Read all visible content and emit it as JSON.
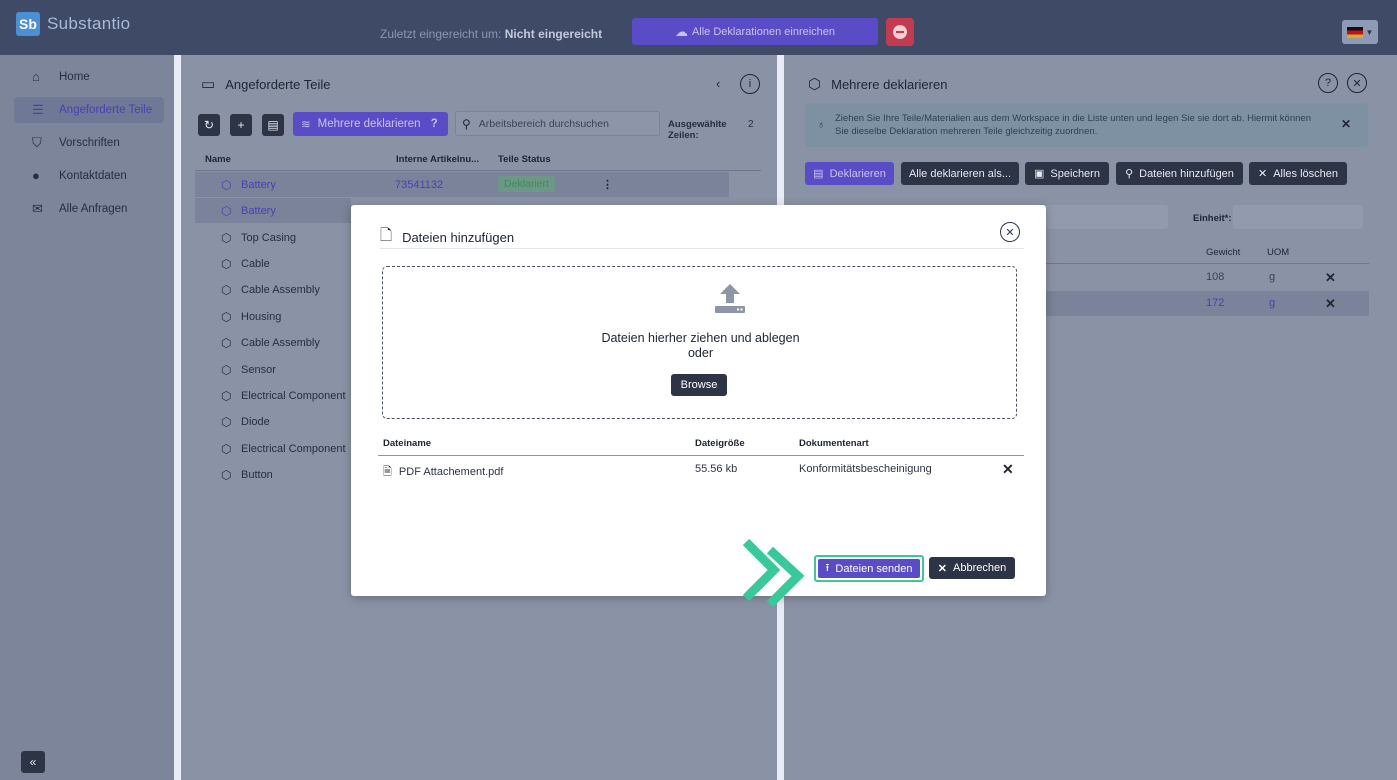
{
  "app": {
    "logo": "Sb",
    "name": "Substantio"
  },
  "header": {
    "last_submitted_label": "Zuletzt eingereicht um:",
    "last_submitted_value": "Nicht eingereicht",
    "submit_all_label": "Alle Deklarationen einreichen",
    "language_flag": "flag-germany-icon"
  },
  "sidebar": {
    "items": [
      {
        "label": "Home",
        "icon": "home-icon",
        "active": false
      },
      {
        "label": "Angeforderte Teile",
        "icon": "list-icon",
        "active": true
      },
      {
        "label": "Vorschriften",
        "icon": "shield-icon",
        "active": false
      },
      {
        "label": "Kontaktdaten",
        "icon": "contacts-icon",
        "active": false
      },
      {
        "label": "Alle Anfragen",
        "icon": "mail-icon",
        "active": false
      }
    ],
    "collapse_label": "«"
  },
  "requested_parts": {
    "title": "Angeforderte Teile",
    "multi_declare_label": "Mehrere deklarieren",
    "help_label": "?",
    "search_placeholder": "Arbeitsbereich durchsuchen",
    "selected_rows_label": "Ausgewählte Zeilen:",
    "selected_rows_count": "2",
    "columns": {
      "name": "Name",
      "article": "Interne Artikelnu...",
      "status": "Teile Status"
    },
    "rows": [
      {
        "name": "Battery",
        "article": "73541132",
        "status": "Deklariert",
        "selected": true
      },
      {
        "name": "Battery",
        "article": "",
        "status": "",
        "selected": true
      },
      {
        "name": "Top Casing",
        "article": "",
        "status": "",
        "selected": false
      },
      {
        "name": "Cable",
        "article": "",
        "status": "",
        "selected": false
      },
      {
        "name": "Cable Assembly",
        "article": "",
        "status": "",
        "selected": false
      },
      {
        "name": "Housing",
        "article": "",
        "status": "",
        "selected": false
      },
      {
        "name": "Cable Assembly",
        "article": "",
        "status": "",
        "selected": false
      },
      {
        "name": "Sensor",
        "article": "",
        "status": "",
        "selected": false
      },
      {
        "name": "Electrical Component",
        "article": "",
        "status": "",
        "selected": false
      },
      {
        "name": "Diode",
        "article": "",
        "status": "",
        "selected": false
      },
      {
        "name": "Electrical Component",
        "article": "",
        "status": "",
        "selected": false
      },
      {
        "name": "Button",
        "article": "",
        "status": "",
        "selected": false
      }
    ]
  },
  "multi_declare": {
    "title": "Mehrere deklarieren",
    "info_text": "Ziehen Sie Ihre Teile/Materialien aus dem Workspace in die Liste unten und legen Sie sie dort ab. Hiermit können Sie dieselbe Deklaration mehreren Teile gleichzeitig zuordnen.",
    "actions": {
      "declare": "Deklarieren",
      "declare_all_as": "Alle deklarieren als...",
      "save": "Speichern",
      "add_files": "Dateien hinzufügen",
      "clear_all": "Alles löschen"
    },
    "unit_label": "Einheit*:",
    "columns": {
      "weight": "Gewicht",
      "uom": "UOM"
    },
    "rows": [
      {
        "weight": "108",
        "uom": "g",
        "selected": false
      },
      {
        "weight": "172",
        "uom": "g",
        "selected": true
      }
    ]
  },
  "modal": {
    "title": "Dateien hinzufügen",
    "drop_text": "Dateien hierher ziehen und ablegen",
    "or_text": "oder",
    "browse_label": "Browse",
    "columns": {
      "filename": "Dateiname",
      "filesize": "Dateigröße",
      "doctype": "Dokumentenart"
    },
    "files": [
      {
        "name": "PDF Attachement.pdf",
        "size": "55.56 kb",
        "type": "Konformitätsbescheinigung"
      }
    ],
    "send_label": "Dateien senden",
    "cancel_label": "Abbrechen"
  },
  "colors": {
    "accent": "#5a4cc6",
    "highlight": "#38c99a",
    "dark": "#2d3446"
  }
}
